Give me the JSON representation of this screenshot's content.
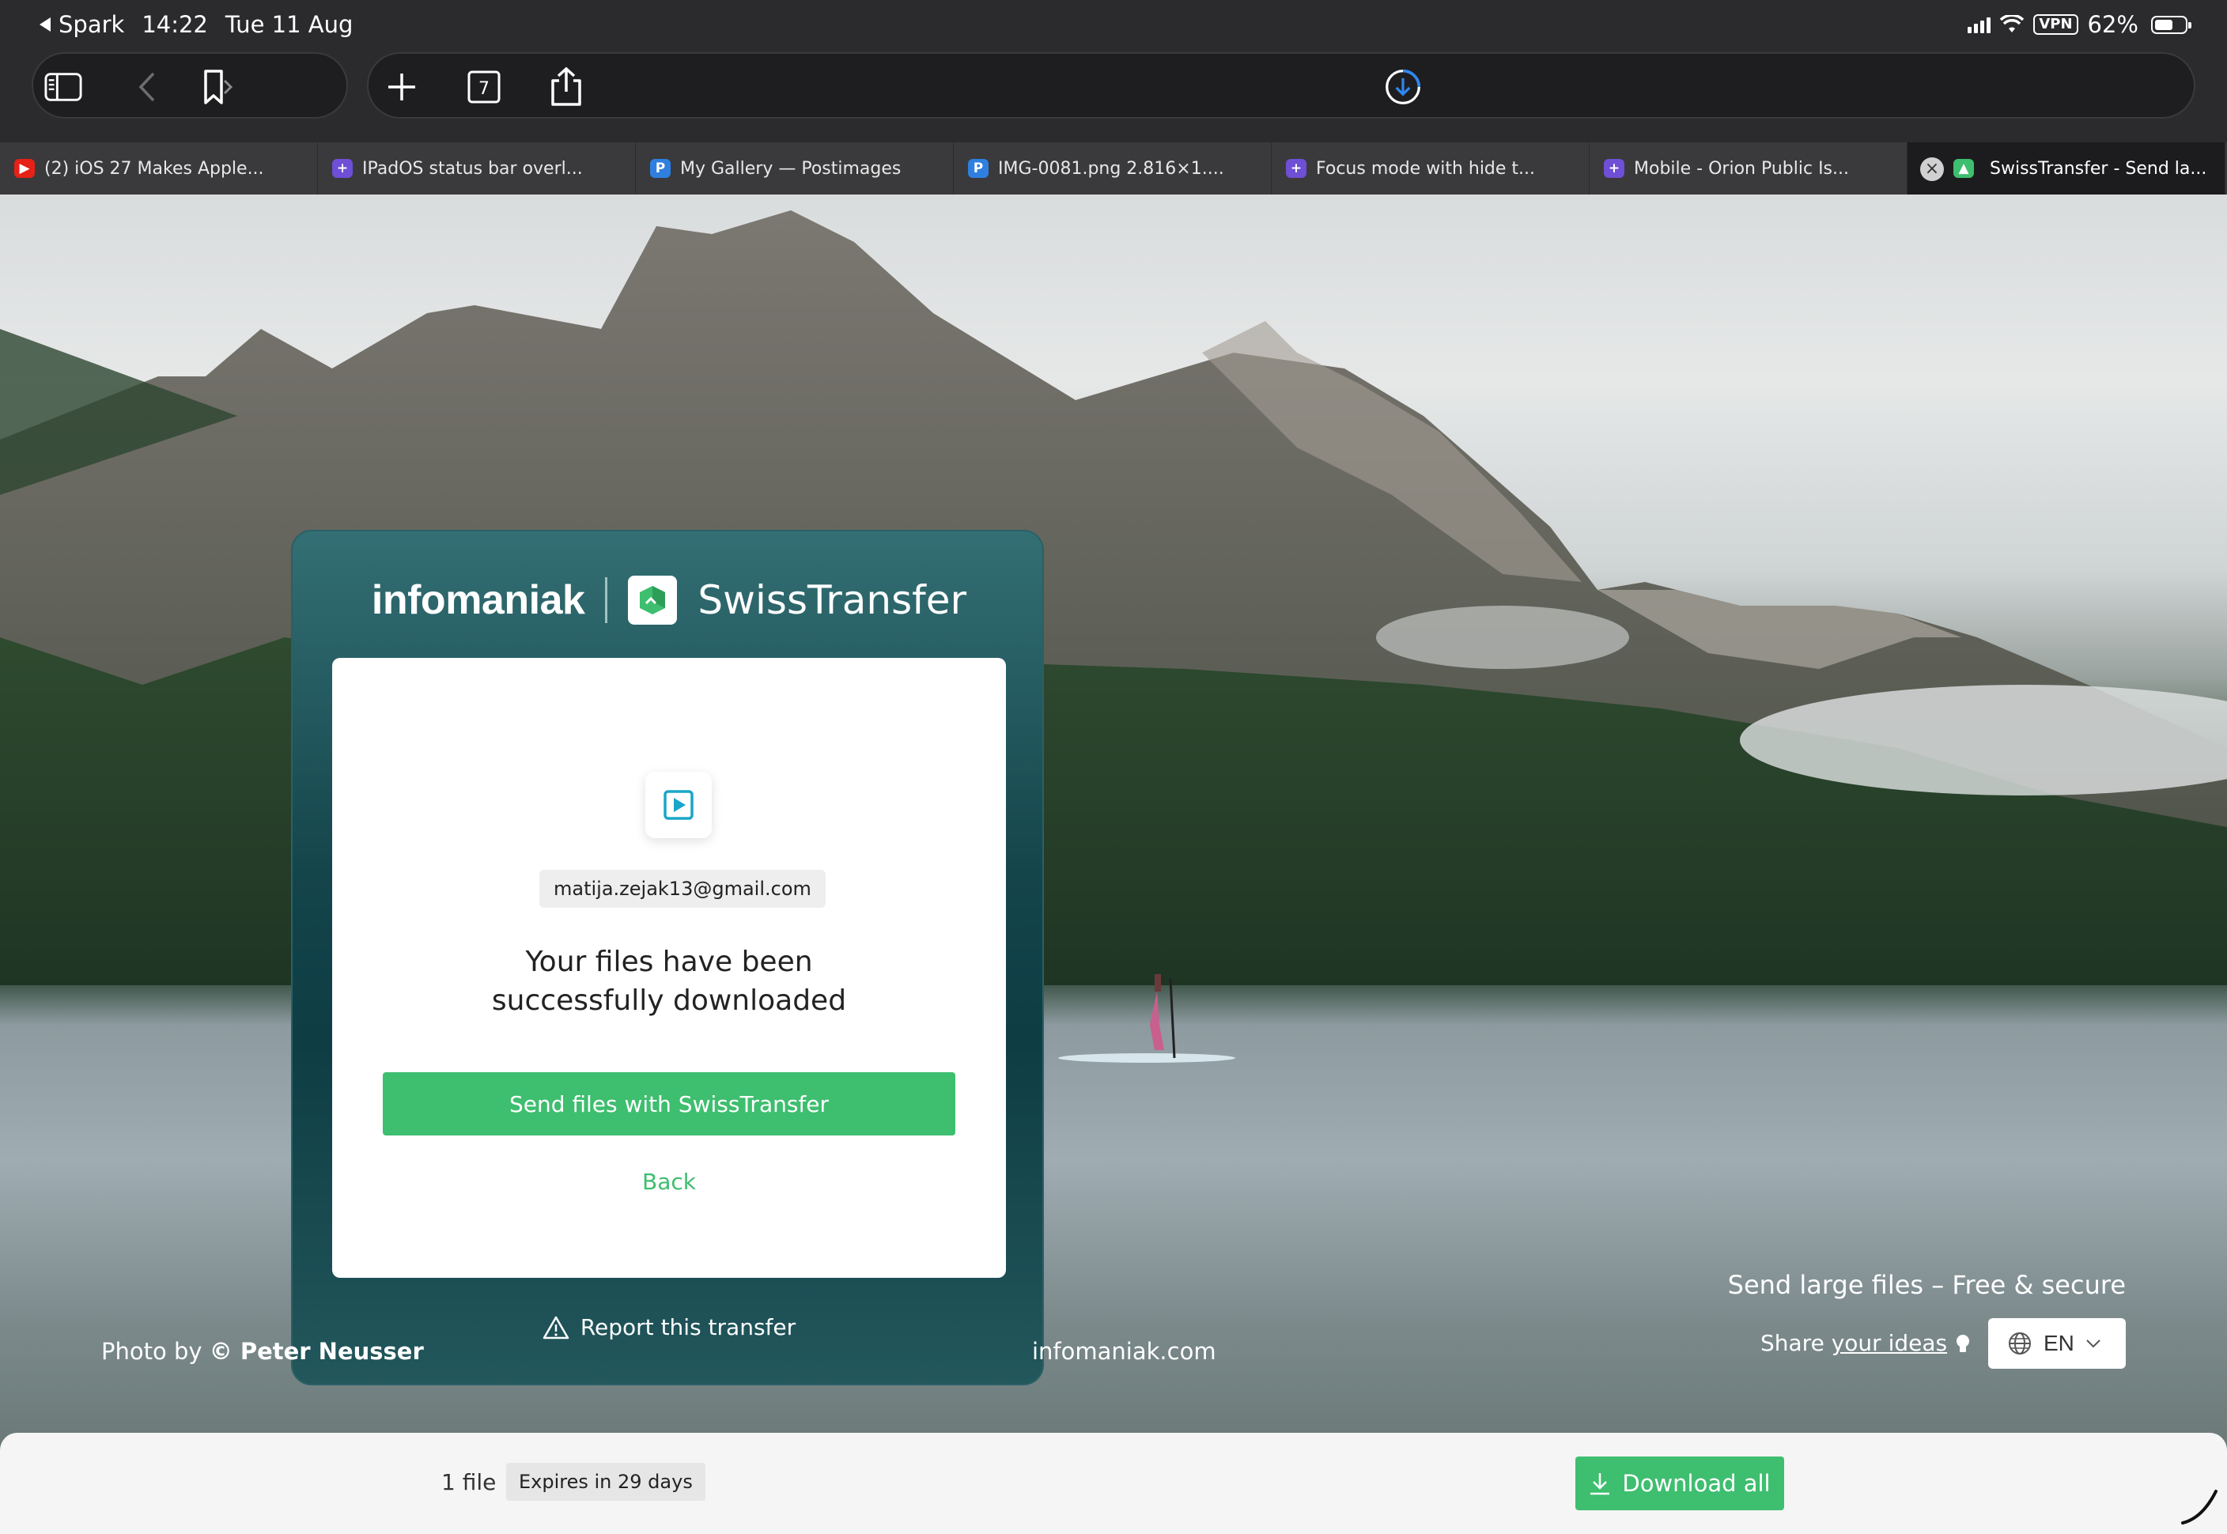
{
  "status_bar": {
    "back_app": "Spark",
    "time": "14:22",
    "date": "Tue 11 Aug",
    "vpn_label": "VPN",
    "battery": "62%",
    "battery_level": 0.62
  },
  "toolbar": {
    "tab_count": "7"
  },
  "tabs": [
    {
      "title": "(2) iOS 27 Makes Apple...",
      "icon": "youtube-icon",
      "color": "#e62117",
      "glyph": "▶"
    },
    {
      "title": "IPadOS status bar overl...",
      "icon": "orion-icon",
      "color": "#6e4fd6",
      "glyph": "+"
    },
    {
      "title": "My Gallery — Postimages",
      "icon": "postimages-icon",
      "color": "#2f7fe0",
      "glyph": "P"
    },
    {
      "title": "IMG-0081.png 2.816×1....",
      "icon": "postimages-icon",
      "color": "#2f7fe0",
      "glyph": "P"
    },
    {
      "title": "Focus mode with hide t...",
      "icon": "orion-icon",
      "color": "#6e4fd6",
      "glyph": "+"
    },
    {
      "title": "Mobile - Orion Public Is...",
      "icon": "orion-icon",
      "color": "#6e4fd6",
      "glyph": "+"
    },
    {
      "title": "SwissTransfer - Send la...",
      "icon": "swisstransfer-icon",
      "color": "#3ebe6f",
      "glyph": "▲",
      "active": true
    }
  ],
  "card": {
    "brand_left": "infomaniak",
    "brand_right": "SwissTransfer",
    "email": "matija.zejak13@gmail.com",
    "headline_line1": "Your files have been",
    "headline_line2": "successfully downloaded",
    "send_button": "Send files with SwissTransfer",
    "back_link": "Back",
    "report_link": "Report this transfer"
  },
  "page": {
    "photo_credit_prefix": "Photo by",
    "photo_credit_name": "© Peter Neusser",
    "site_link": "infomaniak.com",
    "tagline": "Send large files – Free & secure",
    "share_prefix": "Share",
    "share_link": "your ideas",
    "language": "EN"
  },
  "bottom_bar": {
    "file_count": "1 file",
    "expires": "Expires in 29 days",
    "download_all": "Download all"
  },
  "colors": {
    "accent_green": "#3ebe6f",
    "card_teal": "#14454b"
  }
}
